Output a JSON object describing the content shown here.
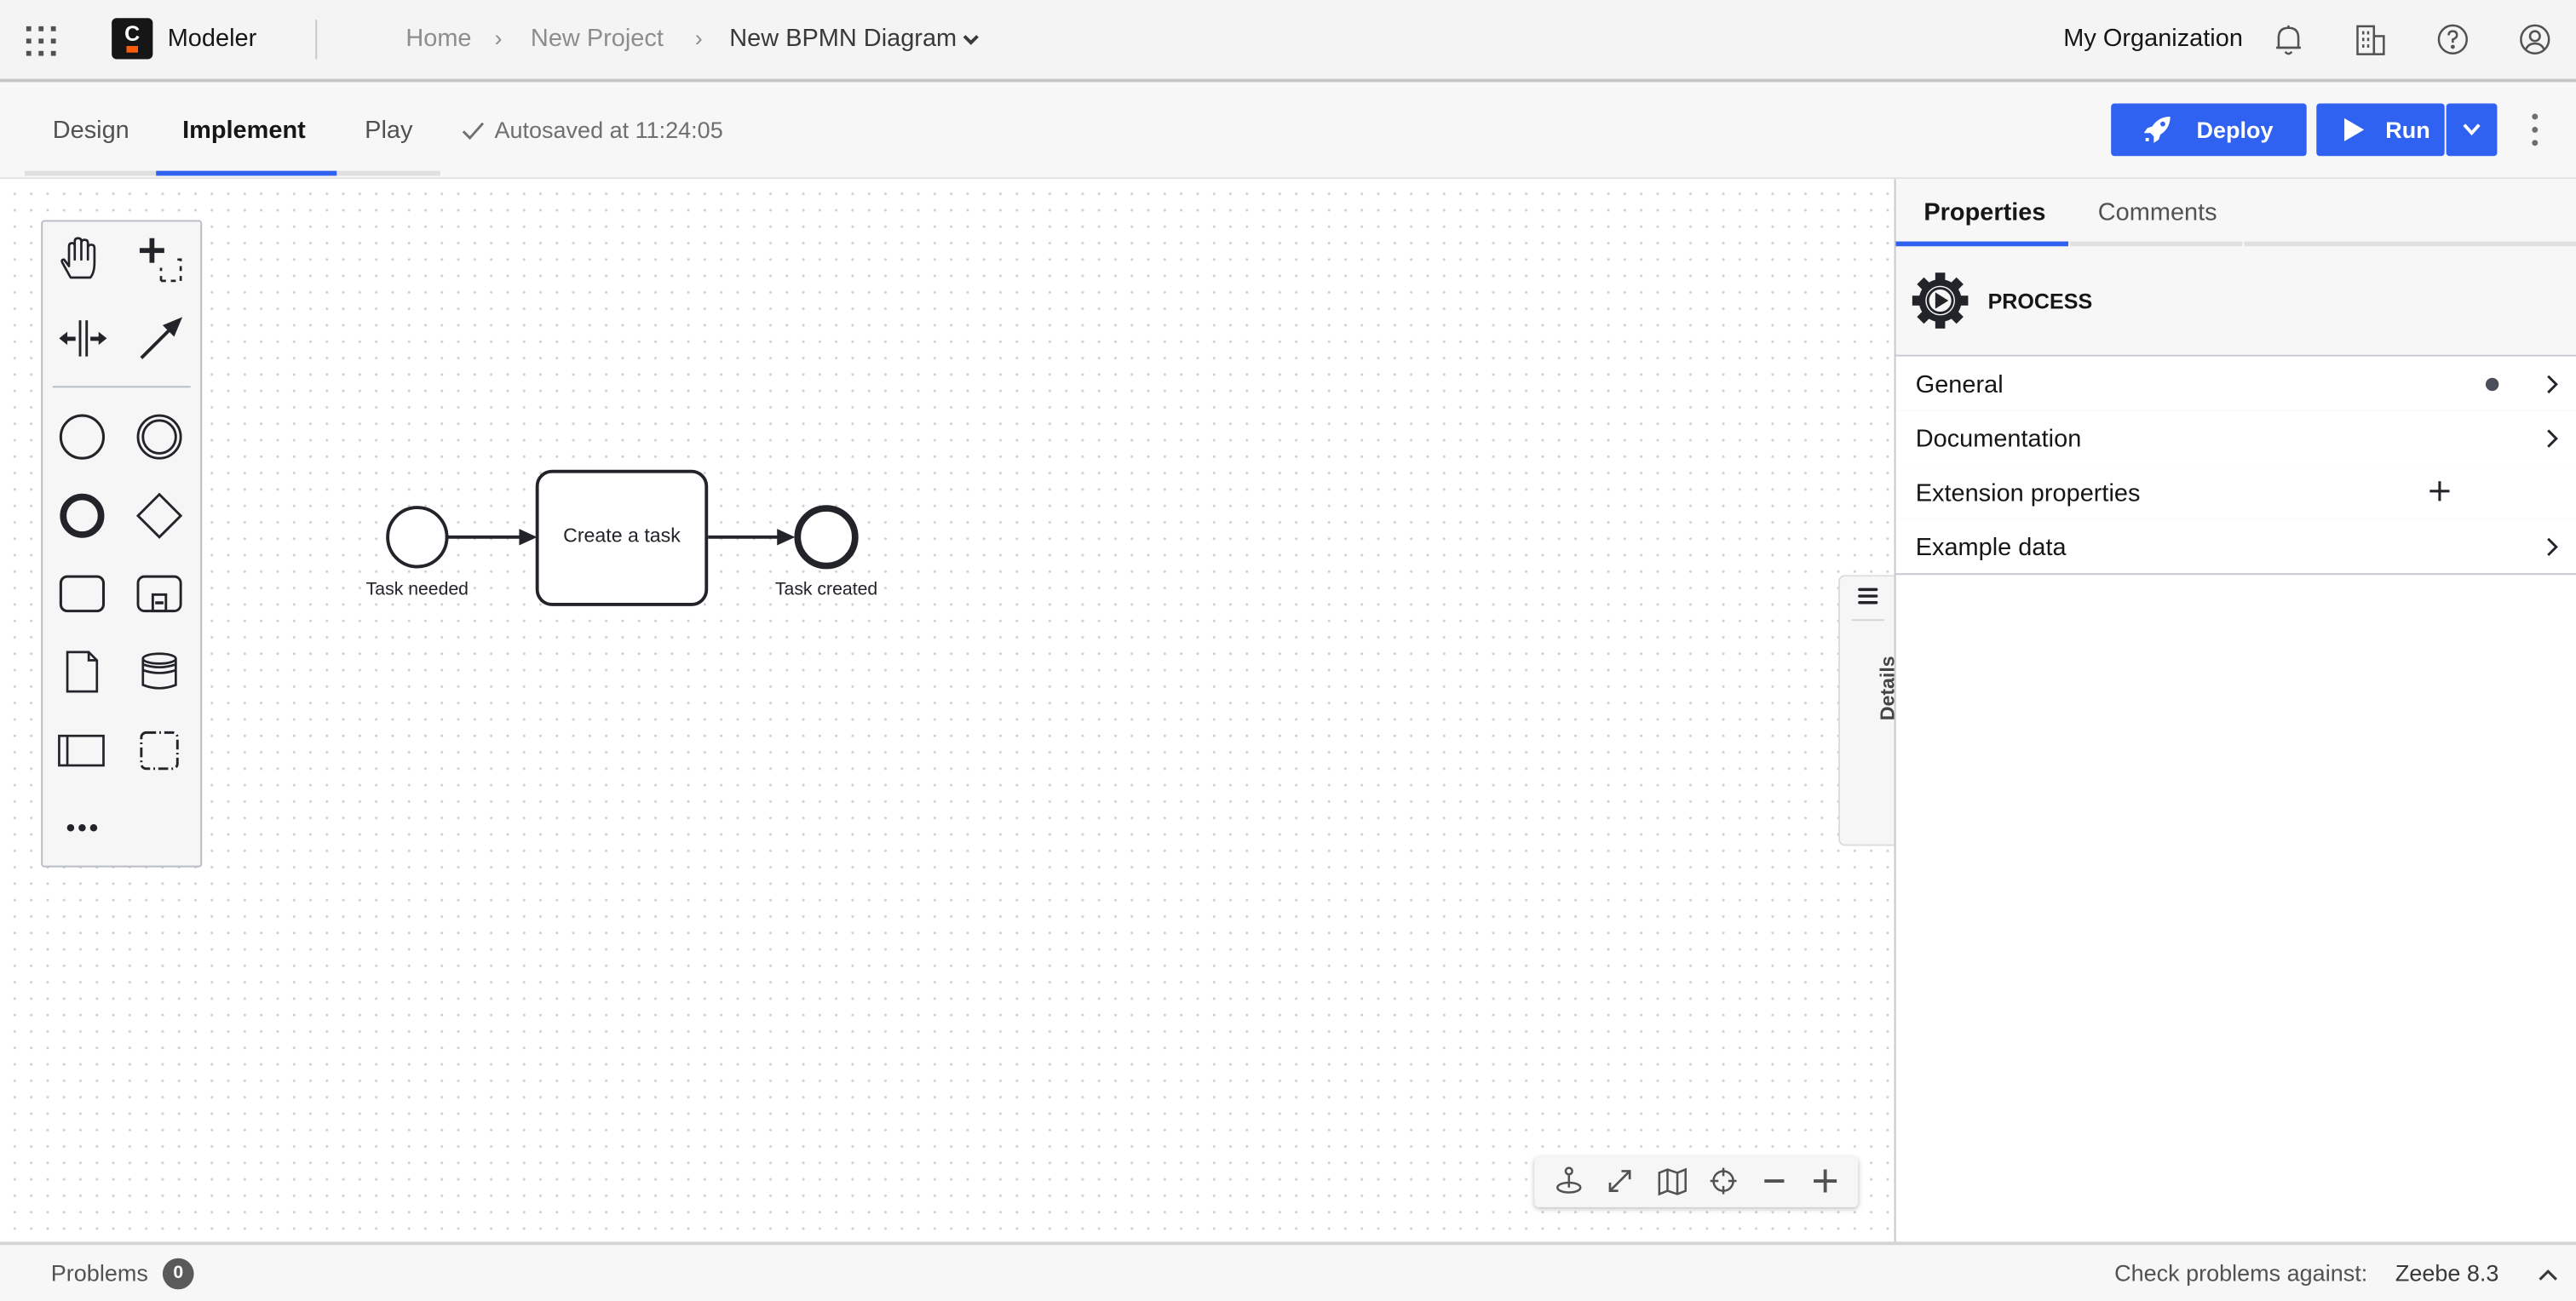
{
  "header": {
    "app_name": "Modeler",
    "logo_letter": "C",
    "breadcrumb": [
      {
        "label": "Home"
      },
      {
        "label": "New Project"
      },
      {
        "label": "New BPMN Diagram"
      }
    ],
    "breadcrumb_separator": "›",
    "organization": "My Organization",
    "icons": [
      "app-switcher-icon",
      "notification-bell-icon",
      "organization-building-icon",
      "help-icon",
      "user-profile-icon"
    ]
  },
  "toolbar": {
    "tabs": [
      {
        "label": "Design",
        "active": false
      },
      {
        "label": "Implement",
        "active": true
      },
      {
        "label": "Play",
        "active": false
      }
    ],
    "autosave": "Autosaved at 11:24:05",
    "deploy_label": "Deploy",
    "run_label": "Run",
    "accent_color": "#2f62f0"
  },
  "palette": {
    "tools": [
      "hand-tool",
      "lasso-tool",
      "space-tool",
      "global-connect-tool"
    ],
    "elements": [
      "start-event",
      "intermediate-event",
      "end-event",
      "gateway",
      "task",
      "subprocess",
      "data-object",
      "data-store",
      "pool-participant",
      "group",
      "more-elements"
    ]
  },
  "diagram": {
    "start_event": {
      "label": "Task needed"
    },
    "task": {
      "label": "Create a task"
    },
    "end_event": {
      "label": "Task created"
    }
  },
  "details_tab": {
    "label": "Details"
  },
  "zoom_controls": [
    "reset-view",
    "fullscreen",
    "minimap",
    "center",
    "zoom-out",
    "zoom-in"
  ],
  "properties_panel": {
    "tabs": [
      {
        "label": "Properties",
        "active": true
      },
      {
        "label": "Comments",
        "active": false
      }
    ],
    "element_type": "PROCESS",
    "groups": [
      {
        "label": "General",
        "has_indicator": true,
        "action": "expand"
      },
      {
        "label": "Documentation",
        "has_indicator": false,
        "action": "expand"
      },
      {
        "label": "Extension properties",
        "has_indicator": false,
        "action": "add"
      },
      {
        "label": "Example data",
        "has_indicator": false,
        "action": "expand"
      }
    ]
  },
  "status_bar": {
    "problems_label": "Problems",
    "problems_count": "0",
    "check_label": "Check problems against:",
    "engine_version": "Zeebe 8.3"
  }
}
